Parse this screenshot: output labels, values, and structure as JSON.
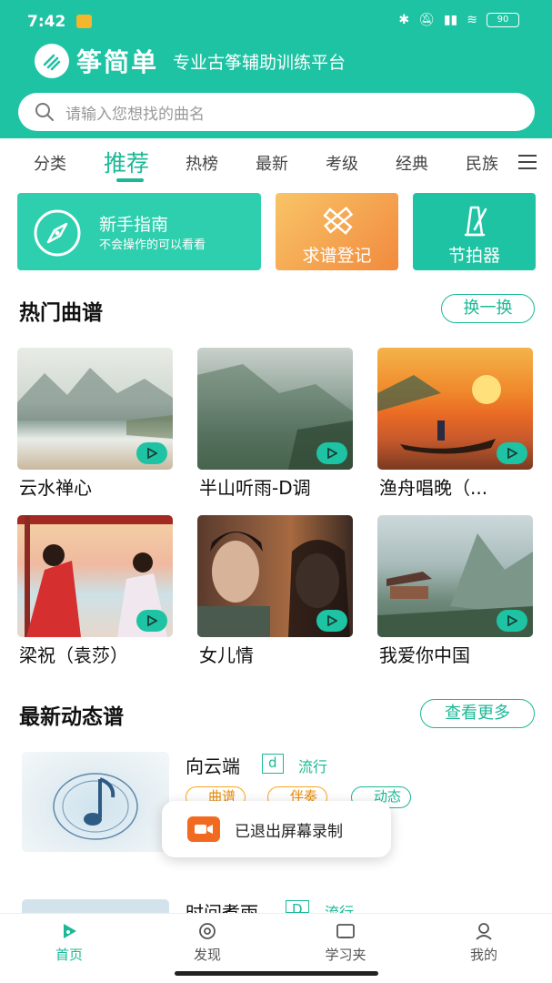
{
  "status_bar": {
    "time": "7:42",
    "battery": "90"
  },
  "brand": {
    "name": "筝简单",
    "slogan": "专业古筝辅助训练平台"
  },
  "search": {
    "placeholder": "请输入您想找的曲名"
  },
  "tabs": [
    "分类",
    "推荐",
    "热榜",
    "最新",
    "考级",
    "经典",
    "民族"
  ],
  "active_tab": "推荐",
  "tools": {
    "guide_title": "新手指南",
    "guide_sub": "不会操作的可以看看",
    "request": "求谱登记",
    "metronome": "节拍器"
  },
  "hot": {
    "title": "热门曲谱",
    "refresh": "换一换",
    "items": [
      {
        "title": "云水禅心"
      },
      {
        "title": "半山听雨-D调"
      },
      {
        "title": "渔舟唱晚（..."
      },
      {
        "title": "梁祝（袁莎）"
      },
      {
        "title": "女儿情"
      },
      {
        "title": "我爱你中国"
      }
    ]
  },
  "latest": {
    "title": "最新动态谱",
    "more": "查看更多",
    "items": [
      {
        "title": "向云端",
        "key": "d",
        "style": "流行",
        "tags": [
          "曲谱",
          "伴奏",
          "动态"
        ]
      },
      {
        "title": "时间煮雨",
        "key": "D",
        "style": "流行"
      }
    ]
  },
  "toast": {
    "text": "已退出屏幕录制"
  },
  "bottom_nav": [
    "首页",
    "发现",
    "学习夹",
    "我的"
  ],
  "colors": {
    "primary": "#1ec3a3",
    "accent": "#1bb896",
    "orange": "#f18a3e"
  }
}
